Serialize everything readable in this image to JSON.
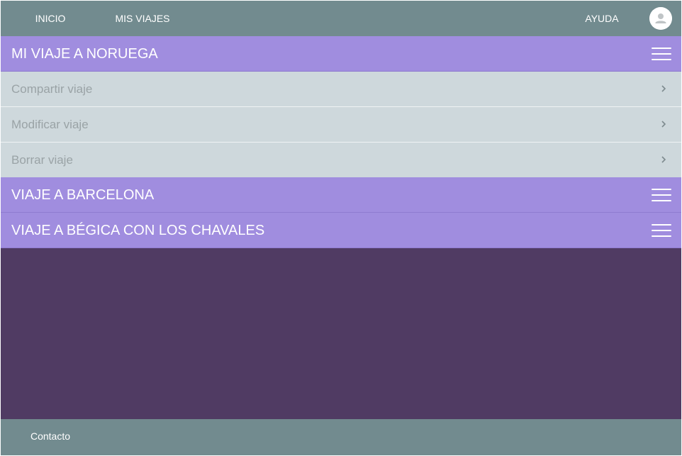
{
  "navbar": {
    "items": [
      {
        "label": "INICIO"
      },
      {
        "label": "MIS VIAJES"
      }
    ],
    "help_label": "AYUDA",
    "avatar_icon": "user-avatar-icon"
  },
  "trips": [
    {
      "title": "MI VIAJE A NORUEGA",
      "expanded": true,
      "actions": [
        {
          "label": "Compartir viaje"
        },
        {
          "label": "Modificar viaje"
        },
        {
          "label": "Borrar viaje"
        }
      ]
    },
    {
      "title": "VIAJE A BARCELONA",
      "expanded": false
    },
    {
      "title": "VIAJE A BÉGICA CON LOS CHAVALES",
      "expanded": false
    }
  ],
  "footer": {
    "contact_label": "Contacto"
  },
  "colors": {
    "navbar": "#728b8f",
    "trip_header": "#a08ddf",
    "action_row": "#ced8dc",
    "content_background": "#503b63"
  }
}
